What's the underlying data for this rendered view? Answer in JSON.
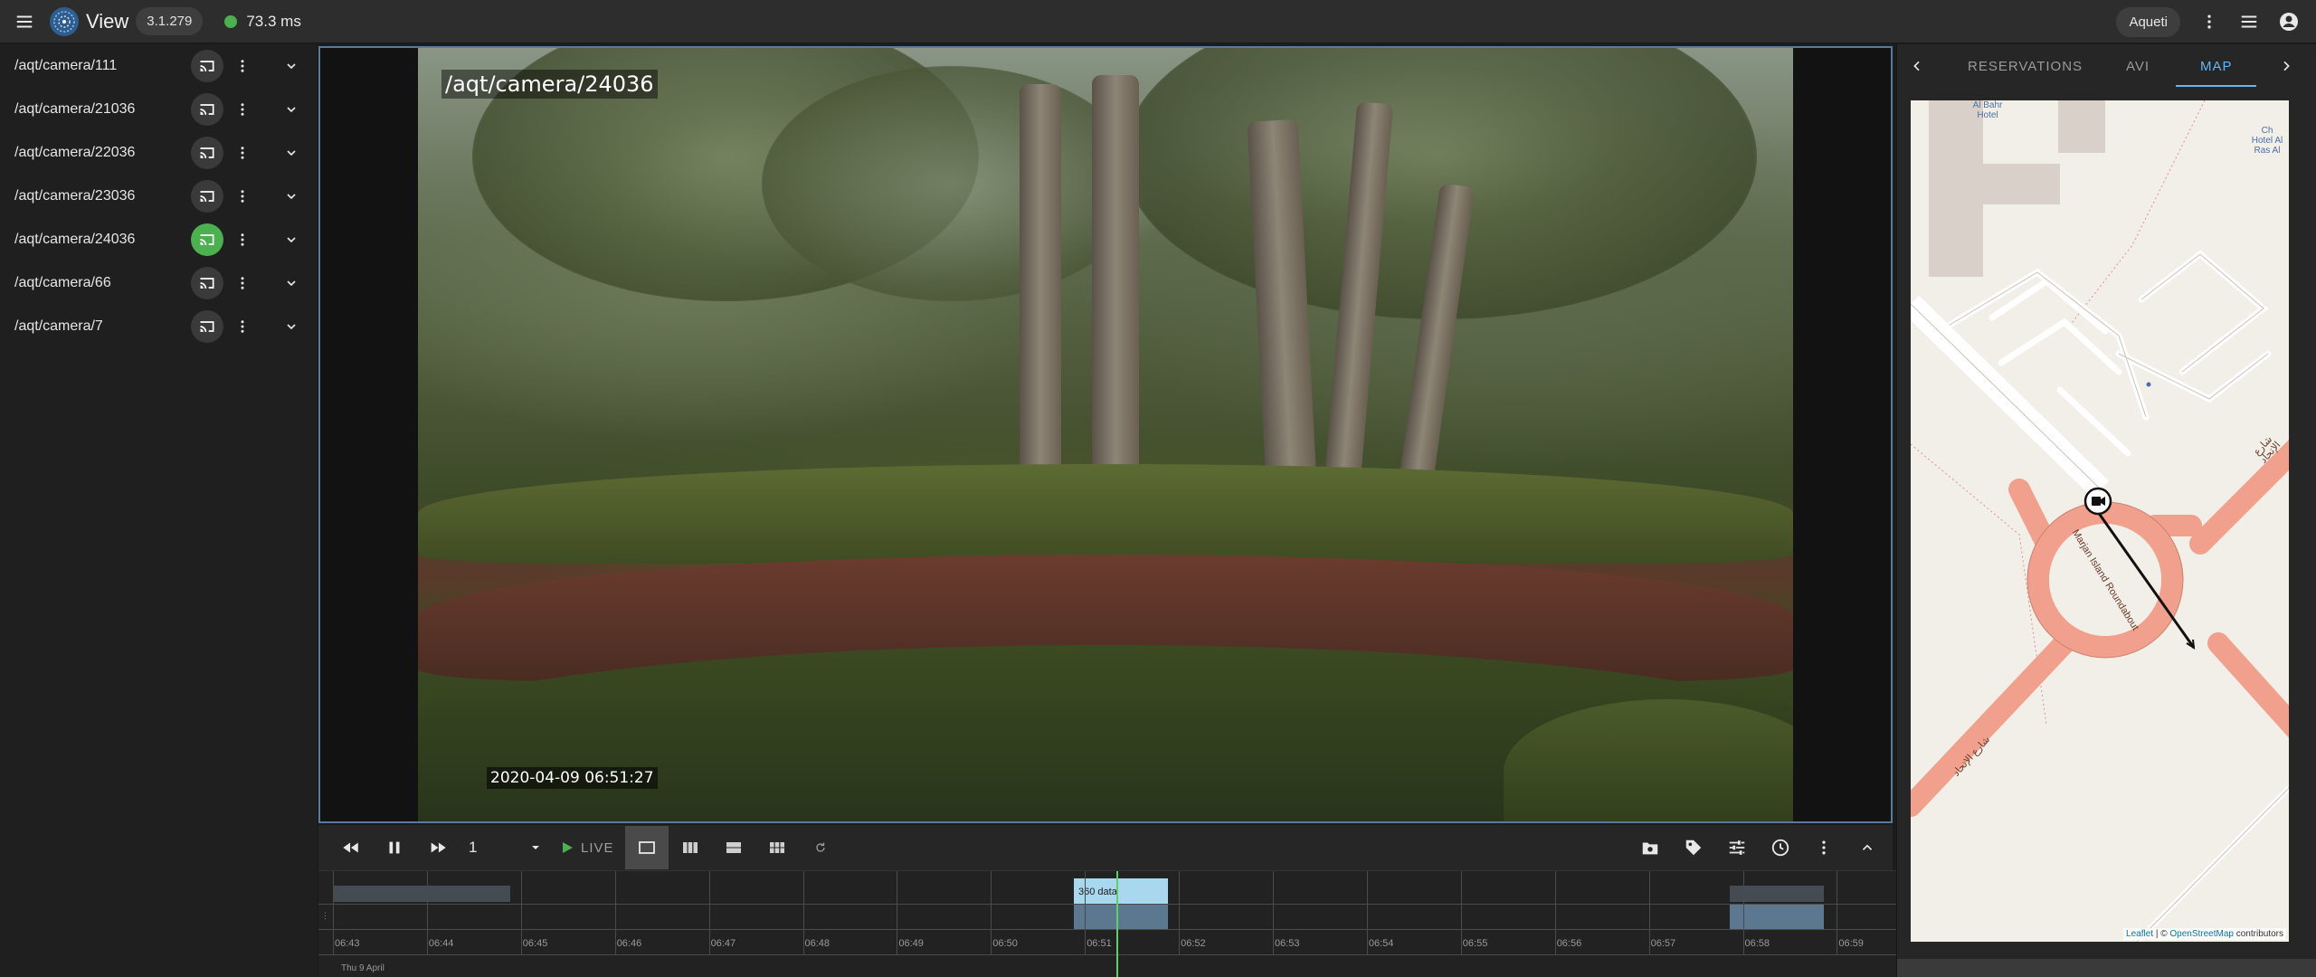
{
  "app": {
    "title": "View",
    "version": "3.1.279",
    "status_color": "#4caf50",
    "latency": "73.3 ms",
    "user": "Aqueti"
  },
  "sidebar": {
    "cameras": [
      {
        "label": "/aqt/camera/111",
        "active": false
      },
      {
        "label": "/aqt/camera/21036",
        "active": false
      },
      {
        "label": "/aqt/camera/22036",
        "active": false
      },
      {
        "label": "/aqt/camera/23036",
        "active": false
      },
      {
        "label": "/aqt/camera/24036",
        "active": true
      },
      {
        "label": "/aqt/camera/66",
        "active": false
      },
      {
        "label": "/aqt/camera/7",
        "active": false
      }
    ]
  },
  "video": {
    "camera_title": "/aqt/camera/24036",
    "timestamp": "2020-04-09 06:51:27"
  },
  "controls": {
    "speed": "1",
    "live_label": "LIVE",
    "live_color": "#4caf50"
  },
  "timeline": {
    "ticks": [
      "06:43",
      "06:44",
      "06:45",
      "06:46",
      "06:47",
      "06:48",
      "06:49",
      "06:50",
      "06:51",
      "06:52",
      "06:53",
      "06:54",
      "06:55",
      "06:56",
      "06:57",
      "06:58",
      "06:59"
    ],
    "segment_label": "360 data",
    "date": "Thu 9 April"
  },
  "right_panel": {
    "tabs": [
      "RESERVATIONS",
      "AVI",
      "MAP"
    ],
    "active_tab": "MAP",
    "map": {
      "labels": {
        "hotel1": "Al Bahr Hotel",
        "hotel2": "Hotel Al Ras Al",
        "hotel2_prefix": "Ch",
        "roundabout": "Marjan Island Roundabout",
        "road": "شارع الإتحاد"
      },
      "attribution": {
        "leaflet": "Leaflet",
        "sep": " | © ",
        "osm": "OpenStreetMap",
        "contributors": " contributors"
      }
    }
  }
}
